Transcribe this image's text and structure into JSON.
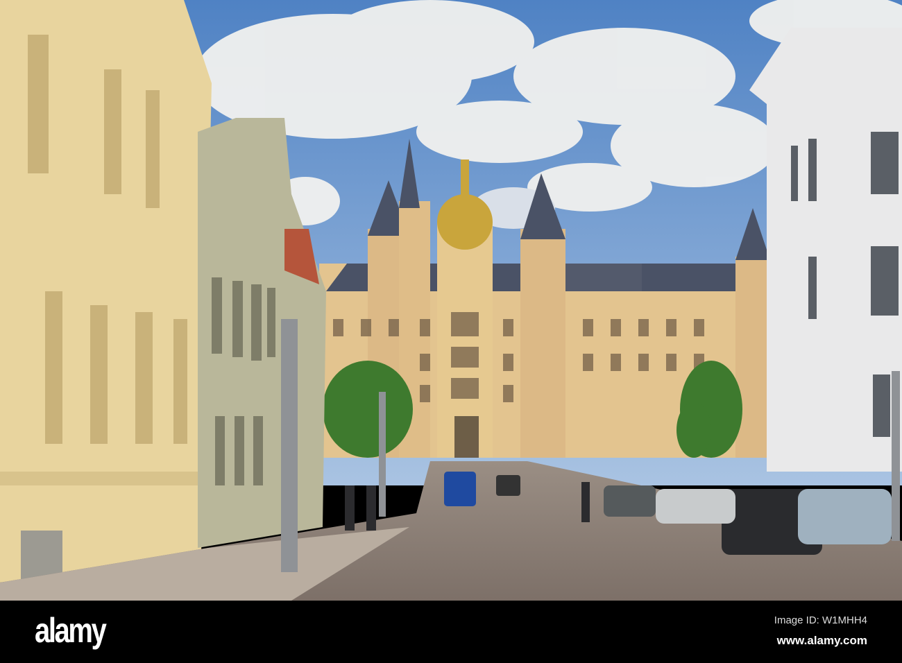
{
  "photo": {
    "subject": "Street view toward a palace",
    "colors": {
      "sky": "#5f8fc8",
      "cloud": "#f2f2f0",
      "castle": "#e3c48f",
      "roof": "#4a5266",
      "gold": "#c9a53c",
      "left_building": "#e8d49e",
      "grey_building": "#b9b79a",
      "right_building": "#e9e9ea",
      "road": "#8a7f76"
    }
  },
  "watermark": {
    "logo": "alamy",
    "image_id": "Image ID: W1MHH4",
    "website": "www.alamy.com"
  }
}
